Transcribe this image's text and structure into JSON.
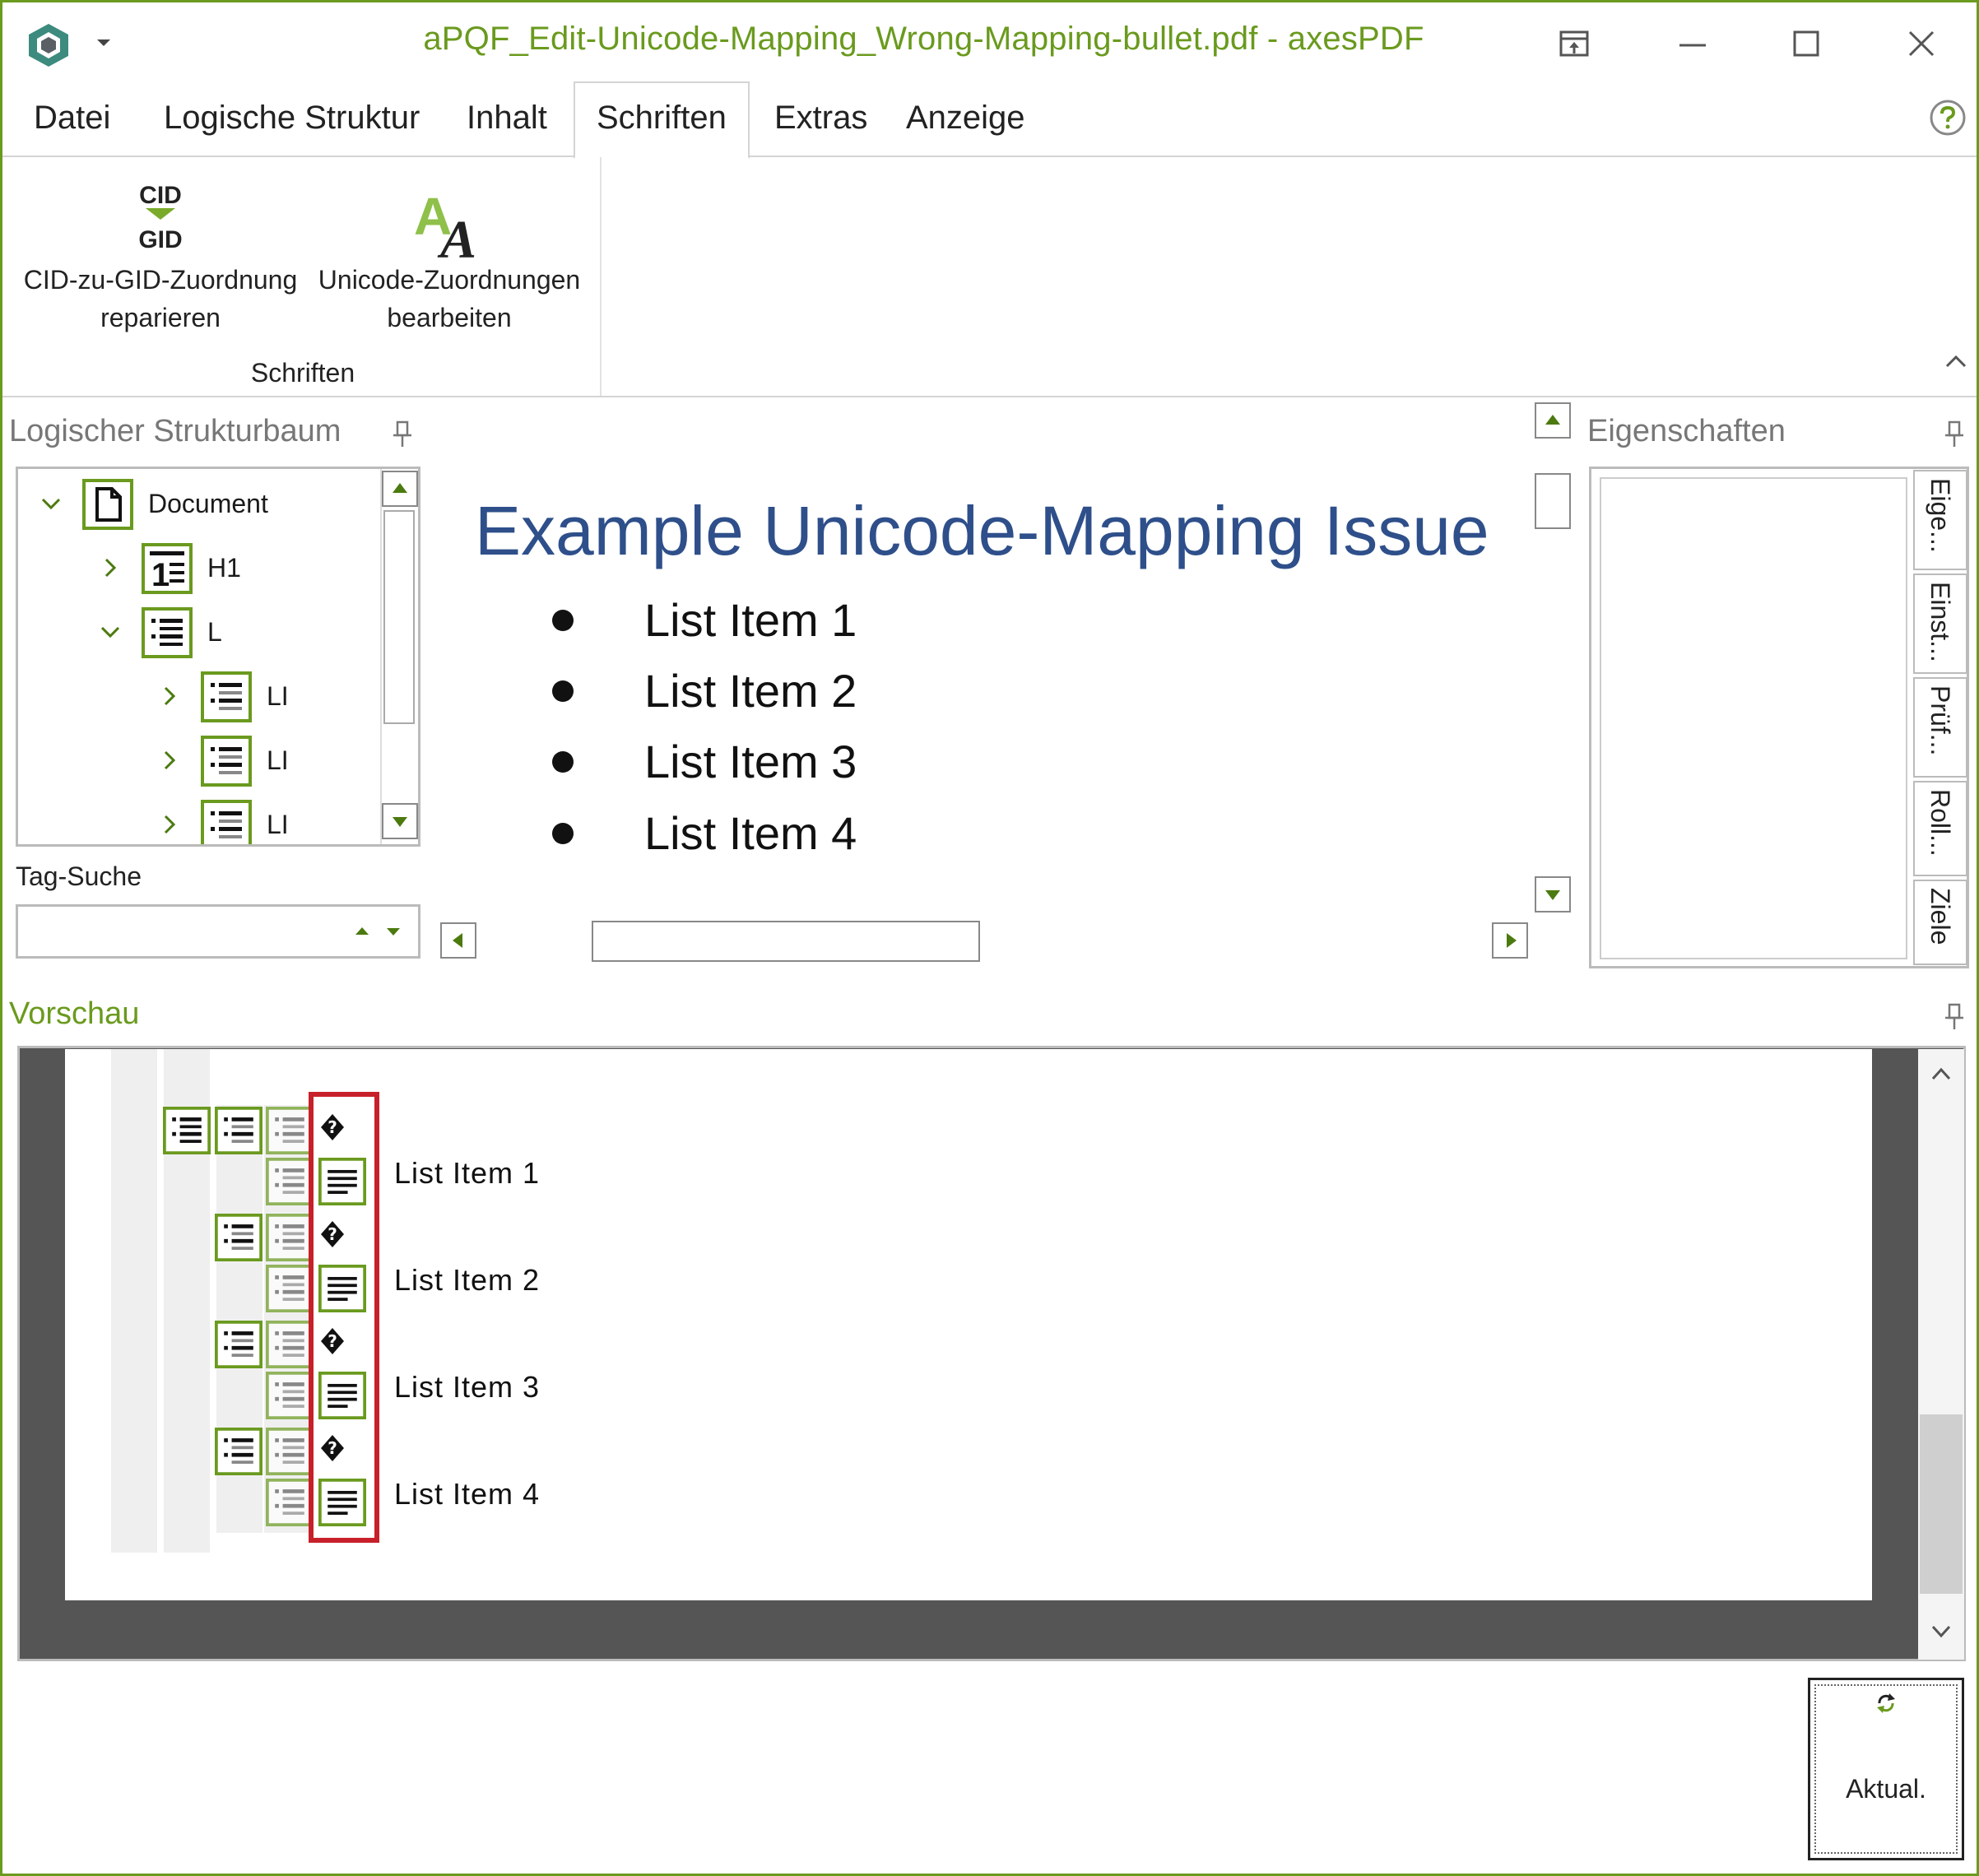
{
  "window": {
    "title": "aPQF_Edit-Unicode-Mapping_Wrong-Mapping-bullet.pdf - axesPDF",
    "accent_color": "#6a9a1e"
  },
  "ribbon": {
    "tabs": [
      "Datei",
      "Logische Struktur",
      "Inhalt",
      "Schriften",
      "Extras",
      "Anzeige"
    ],
    "active_tab": "Schriften",
    "cid_icon_top": "CID",
    "cid_icon_bottom": "GID",
    "buttons": [
      {
        "line1": "CID-zu-GID-Zuordnung",
        "line2": "reparieren",
        "icon": "cid-gid-icon"
      },
      {
        "line1": "Unicode-Zuordnungen",
        "line2": "bearbeiten",
        "icon": "unicode-font-icon"
      }
    ],
    "group_label": "Schriften"
  },
  "structure_panel": {
    "title": "Logischer Strukturbaum",
    "tree": [
      {
        "label": "Document",
        "level": 0,
        "expanded": true,
        "icon": "document-tag-icon"
      },
      {
        "label": "H1",
        "level": 1,
        "expanded": false,
        "icon": "heading-tag-icon"
      },
      {
        "label": "L",
        "level": 1,
        "expanded": true,
        "icon": "list-tag-icon"
      },
      {
        "label": "LI",
        "level": 2,
        "expanded": false,
        "icon": "list-item-tag-icon"
      },
      {
        "label": "LI",
        "level": 2,
        "expanded": false,
        "icon": "list-item-tag-icon"
      },
      {
        "label": "LI",
        "level": 2,
        "expanded": false,
        "icon": "list-item-tag-icon"
      }
    ],
    "tag_search_label": "Tag-Suche",
    "tag_search_value": ""
  },
  "document_view": {
    "heading": "Example Unicode-Mapping Issue",
    "list_items": [
      "List Item 1",
      "List Item 2",
      "List Item 3",
      "List Item 4"
    ],
    "heading_color": "#2e4f8a"
  },
  "properties_panel": {
    "title": "Eigenschaften",
    "side_tabs": [
      "Eige...",
      "Einst...",
      "Prüf...",
      "Roll...",
      "Ziele"
    ]
  },
  "preview_panel": {
    "title": "Vorschau",
    "rows": [
      {
        "lbl_glyph": "�",
        "text": "List Item 1"
      },
      {
        "lbl_glyph": "�",
        "text": "List Item 2"
      },
      {
        "lbl_glyph": "�",
        "text": "List Item 3"
      },
      {
        "lbl_glyph": "�",
        "text": "List Item 4"
      }
    ],
    "highlight_color": "#c8202a",
    "refresh_label": "Aktual."
  }
}
